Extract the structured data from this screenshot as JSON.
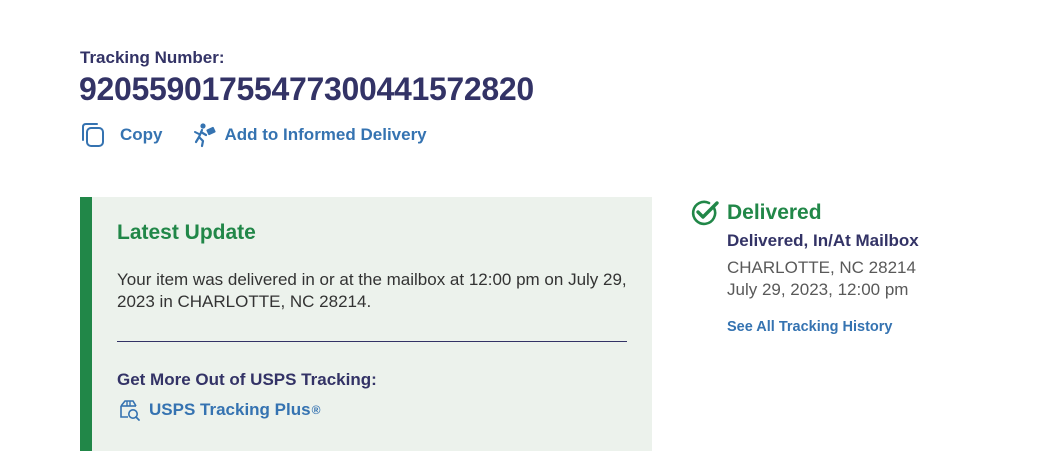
{
  "tracking": {
    "label": "Tracking Number:",
    "number": "92055901755477300441572820"
  },
  "actions": {
    "copy_label": "Copy",
    "informed_label": "Add to Informed Delivery"
  },
  "latest_update": {
    "title": "Latest Update",
    "text": "Your item was delivered in or at the mailbox at 12:00 pm on July 29, 2023 in CHARLOTTE, NC 28214.",
    "more_label": "Get More Out of USPS Tracking:",
    "plus_label": "USPS Tracking Plus",
    "plus_mark": "®"
  },
  "status": {
    "title": "Delivered",
    "detail": "Delivered, In/At Mailbox",
    "location": "CHARLOTTE, NC 28214",
    "date": "July 29, 2023, 12:00 pm",
    "history_link": "See All Tracking History"
  },
  "icons": {
    "copy": "copy-icon",
    "informed": "mail-carrier-icon",
    "plus": "tracking-plus-icon",
    "delivered": "check-circle-icon"
  },
  "colors": {
    "navy": "#333366",
    "green": "#218748",
    "link_blue": "#3573b1",
    "panel_bg": "#ecf2ec"
  }
}
